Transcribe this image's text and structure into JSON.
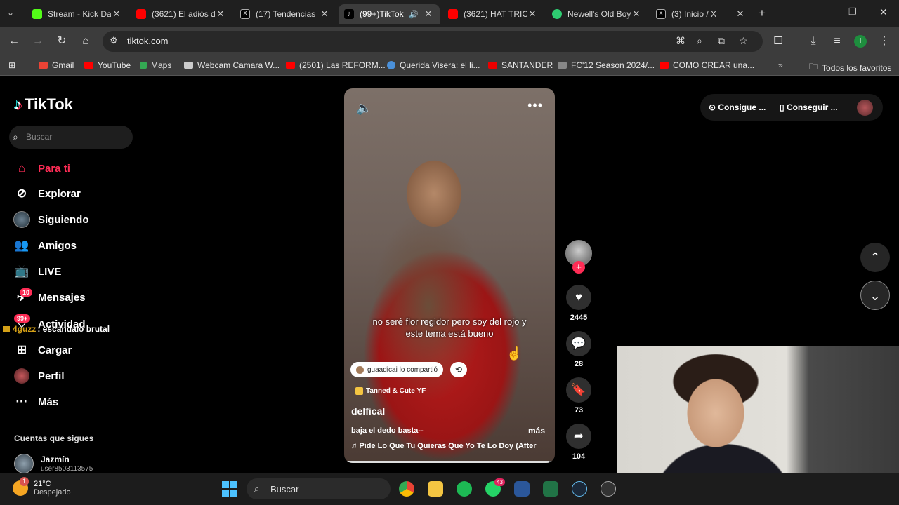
{
  "browser": {
    "tabs": [
      {
        "title": "Stream - Kick Da",
        "color": "#53fc18"
      },
      {
        "title": "(3621) El adiós d",
        "color": "#ff0000"
      },
      {
        "title": "(17) Tendencias",
        "color": "#ffffff"
      },
      {
        "title": "(99+)TikTok",
        "color": "#ffffff"
      },
      {
        "title": "(3621) HAT TRIC",
        "color": "#ff0000"
      },
      {
        "title": "Newell's Old Boy",
        "color": "#2ecc71"
      },
      {
        "title": "(3) Inicio / X",
        "color": "#ffffff"
      }
    ],
    "url": "tiktok.com",
    "bookmarks": [
      {
        "label": "Gmail",
        "color": "#ea4335"
      },
      {
        "label": "YouTube",
        "color": "#ff0000"
      },
      {
        "label": "Maps",
        "color": "#34a853"
      },
      {
        "label": "Webcam Camara W...",
        "color": "#cccccc"
      },
      {
        "label": "(2501) Las REFORM...",
        "color": "#ff0000"
      },
      {
        "label": "Querida Visera: el li...",
        "color": "#4a90d9"
      },
      {
        "label": "SANTANDER",
        "color": "#ec0000"
      },
      {
        "label": "FC'12 Season 2024/...",
        "color": "#888888"
      },
      {
        "label": "COMO CREAR una...",
        "color": "#ff0000"
      }
    ],
    "all_bookmarks": "Todos los favoritos"
  },
  "tiktok": {
    "logo": "TikTok",
    "search_placeholder": "Buscar",
    "nav": [
      {
        "label": "Para ti",
        "icon": "home-icon"
      },
      {
        "label": "Explorar",
        "icon": "compass-icon"
      },
      {
        "label": "Siguiendo",
        "icon": "following-avatar-icon"
      },
      {
        "label": "Amigos",
        "icon": "friends-icon"
      },
      {
        "label": "LIVE",
        "icon": "live-icon"
      },
      {
        "label": "Mensajes",
        "icon": "messages-icon",
        "badge": "10"
      },
      {
        "label": "Actividad",
        "icon": "activity-icon",
        "badge": "99+"
      },
      {
        "label": "Cargar",
        "icon": "upload-icon"
      },
      {
        "label": "Perfil",
        "icon": "profile-avatar-icon"
      },
      {
        "label": "Más",
        "icon": "more-icon"
      }
    ],
    "stream_chat": {
      "user": "4guzz",
      "message": ": escandalo brutal"
    },
    "following_title": "Cuentas que sigues",
    "following": [
      {
        "name": "Jazmín",
        "user": "user8503113575"
      }
    ],
    "header_buttons": {
      "coins": "Consigue ...",
      "app": "Conseguir ..."
    },
    "video": {
      "caption": "no seré flor regidor pero soy del rojo y este tema está bueno",
      "shared_by": "guaadicai lo compartió",
      "effect": "Tanned & Cute YF",
      "author": "delfical",
      "description": "baja el dedo basta--",
      "more": "más",
      "music": "Pide Lo Que Tu Quieras Que Yo Te Lo Doy (After",
      "progress": 0.97
    },
    "actions": {
      "likes": "2445",
      "comments": "28",
      "saves": "73",
      "shares": "104"
    }
  },
  "taskbar": {
    "temperature": "21°C",
    "weather": "Despejado",
    "weather_badge": "1",
    "search": "Buscar",
    "whatsapp_badge": "43"
  }
}
